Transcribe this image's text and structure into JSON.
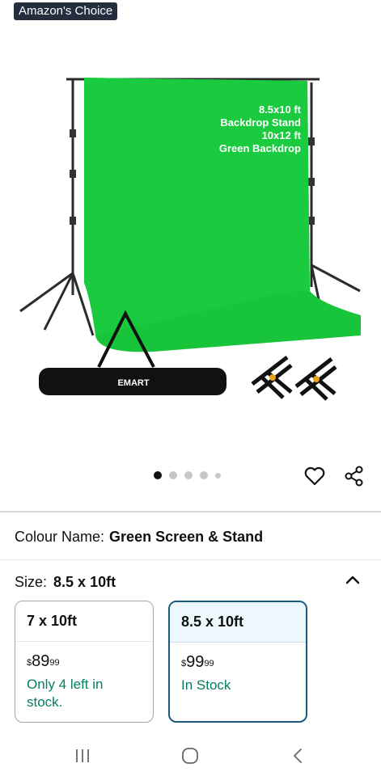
{
  "badge": "Amazon's Choice",
  "image": {
    "overlay_lines": [
      "8.5x10 ft",
      "Backdrop Stand",
      "10x12 ft",
      "Green Backdrop"
    ],
    "bag_brand": "EMART",
    "backdrop_color": "#17c43a"
  },
  "carousel": {
    "count": 5,
    "active": 0
  },
  "colour": {
    "label": "Colour Name:",
    "value": "Green Screen & Stand"
  },
  "size": {
    "label": "Size:",
    "value": "8.5 x 10ft"
  },
  "options": [
    {
      "title": "7 x 10ft",
      "price_currency": "$",
      "price_whole": "89",
      "price_fraction": "99",
      "stock": "Only 4 left in stock.",
      "selected": false
    },
    {
      "title": "8.5 x 10ft",
      "price_currency": "$",
      "price_whole": "99",
      "price_fraction": "99",
      "stock": "In Stock",
      "selected": true
    }
  ],
  "colors": {
    "accent_border": "#1c5a7b",
    "stock_green": "#067d62",
    "badge_bg": "#232f3e"
  },
  "icons": [
    "heart-icon",
    "share-icon",
    "chevron-up-icon",
    "recent-apps-icon",
    "home-icon",
    "back-icon"
  ]
}
